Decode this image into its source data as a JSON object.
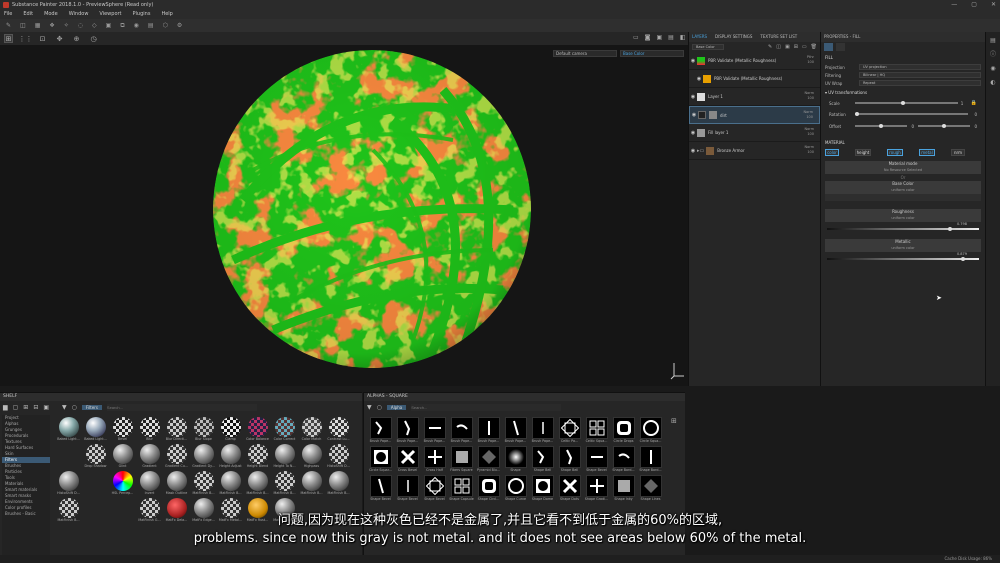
{
  "window": {
    "title": "Substance Painter 2018.1.0 - PreviewSphere (Read only)",
    "controls": [
      "—",
      "▢",
      "✕"
    ]
  },
  "menu": [
    "File",
    "Edit",
    "Mode",
    "Window",
    "Viewport",
    "Plugins",
    "Help"
  ],
  "viewport": {
    "camera_select": "Default camera",
    "channel_select": "Base Color"
  },
  "layers_panel": {
    "tabs": [
      "LAYERS",
      "DISPLAY SETTINGS",
      "TEXTURE SET LIST"
    ],
    "channel": "Base Color",
    "rows": [
      {
        "name": "PBR Validate (Metallic Roughness)",
        "blend": "Pthr",
        "opacity": "100"
      },
      {
        "name": "PBR Validate (Metallic Roughness)",
        "blend": "",
        "opacity": ""
      },
      {
        "name": "Layer 1",
        "blend": "Norm",
        "opacity": "100"
      },
      {
        "name": "dirt",
        "blend": "Norm",
        "opacity": "100"
      },
      {
        "name": "Fill layer 1",
        "blend": "Norm",
        "opacity": "100"
      },
      {
        "name": "Bronze Armor",
        "blend": "Norm",
        "opacity": "100"
      }
    ]
  },
  "properties": {
    "title": "PROPERTIES - FILL",
    "fill_header": "FILL",
    "projection_label": "Projection",
    "projection": "UV projection",
    "filtering_label": "Filtering",
    "filtering": "Bilinear | HQ",
    "uvwrap_label": "UV Wrap",
    "uvwrap": "Repeat",
    "uv_header": "UV transformations",
    "scale_label": "Scale",
    "scale_value": "1",
    "rotation_label": "Rotation",
    "rotation_value": "0",
    "offset_label": "Offset",
    "offset_x": "0",
    "offset_y": "0",
    "material_header": "MATERIAL",
    "material_buttons": [
      "color",
      "height",
      "rough",
      "metal",
      "nrm"
    ],
    "material_mode_label": "Material mode",
    "material_mode_value": "No Resource Selected",
    "base_color_label": "Base Color",
    "base_color_sub": "uniform color",
    "roughness_label": "Roughness",
    "roughness_sub": "uniform color",
    "roughness_value": "0.798",
    "roughness_fraction": 0.798,
    "metallic_label": "Metallic",
    "metallic_sub": "uniform color",
    "metallic_value": "0.879",
    "metallic_fraction": 0.879
  },
  "shelf": {
    "title": "SHELF",
    "filter_tag": "Filters",
    "search_placeholder": "Search...",
    "categories": [
      "Project",
      "Alphas",
      "Grunges",
      "Procedurals",
      "Textures",
      "Hard Surfaces",
      "Skin",
      "Filters",
      "Brushes",
      "Particles",
      "Tools",
      "Materials",
      "Smart materials",
      "Smart masks",
      "Environments",
      "Color profiles",
      "Brushes - Basic"
    ],
    "selected_category": "Filters",
    "items": [
      "Baked Light...",
      "Baked Light...",
      "Bevel",
      "Blur",
      "Blur Directi...",
      "Blur Slope",
      "Clamp",
      "Color Balance",
      "Color Correct",
      "Color Match",
      "Contrast Lu...",
      "",
      "Drop Shadow",
      "Glint",
      "Gradient",
      "Gradient Cu...",
      "Gradient Dy...",
      "Height Adjust",
      "Height Blend",
      "Height To N...",
      "Highpass",
      "HistoShift D...",
      "HistoShift D...",
      "",
      "HSL Percep...",
      "Invert",
      "Mask Outline",
      "MatFinish B...",
      "MatFinish B...",
      "MatFinish B...",
      "MatFinish B...",
      "MatFinish B...",
      "MatFinish B...",
      "MatFinish B...",
      "",
      "",
      "MatFinish G...",
      "MatFx Dela...",
      "MatFx Edge...",
      "MatFx Metal...",
      "MatFx Rust...",
      "MatFx Shap...",
      "",
      "",
      "",
      "",
      ""
    ]
  },
  "alphas": {
    "title": "ALPHAS - SQUARE",
    "filter_tag": "Alpha",
    "search_placeholder": "Search...",
    "items": [
      "Brush Pape...",
      "Brush Pape...",
      "Brush Pape...",
      "Brush Pape...",
      "Brush Pape...",
      "Brush Pape...",
      "Brush Pape...",
      "Celtic Pa...",
      "Celtic Squa...",
      "Circle Drops",
      "Circle Squa...",
      "Circle Squar...",
      "Cross Bevel",
      "Cross Half",
      "Fibers Square",
      "Pyramid Blu...",
      "Shape",
      "Shape Bell",
      "Shape Bell",
      "Shape Bevel",
      "Shape Bord...",
      "Shape Bord...",
      "Shape Bevel",
      "Shape Bevel",
      "Shape Bevel",
      "Shape Capsule",
      "Shape Circl...",
      "Shape Curve",
      "Shape Dome",
      "Shape Dots",
      "Shape Gradi...",
      "Shape Inky",
      "Shape Lines"
    ]
  },
  "subtitles": {
    "zh": "问题,因为现在这种灰色已经不是金属了,并且它看不到低于金属的60%的区域,",
    "en": "problems. since now this gray is not metal. and it does not see areas below 60% of the metal."
  },
  "status": {
    "text": "Cache Disk Usage: 86%"
  }
}
